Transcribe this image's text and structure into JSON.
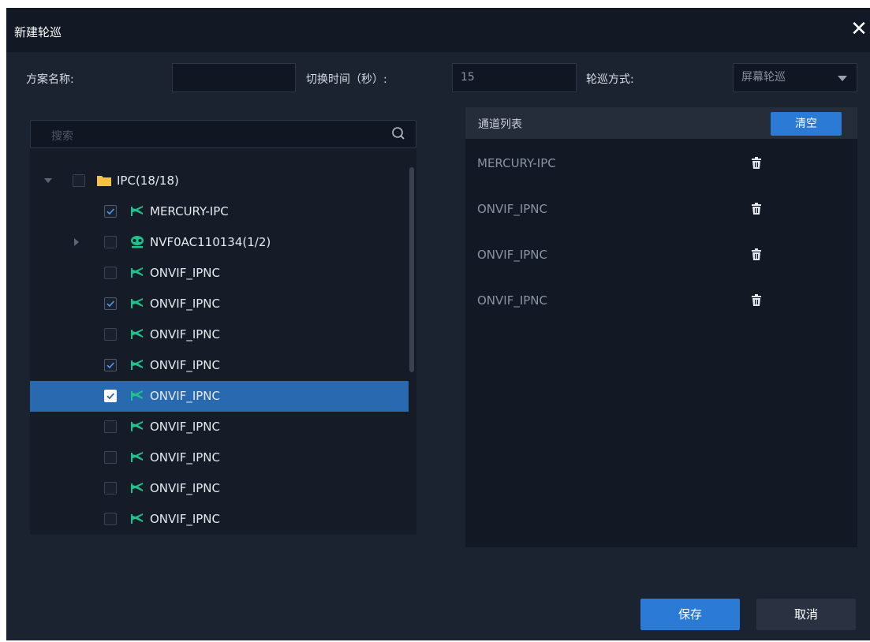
{
  "dialog": {
    "title": "新建轮巡",
    "close_glyph": "✕"
  },
  "form": {
    "scheme_label": "方案名称:",
    "scheme_value": "",
    "switch_label": "切换时间（秒）:",
    "switch_value": "15",
    "mode_label": "轮巡方式:",
    "mode_value": "屏幕轮巡"
  },
  "tree": {
    "search_placeholder": "搜索",
    "root": {
      "label": "IPC(18/18)",
      "checked": false,
      "expanded": true
    },
    "items": [
      {
        "label": "MERCURY-IPC",
        "checked": true,
        "type": "camera"
      },
      {
        "label": "NVF0AC110134(1/2)",
        "checked": false,
        "type": "nvr"
      },
      {
        "label": "ONVIF_IPNC",
        "checked": false,
        "type": "camera"
      },
      {
        "label": "ONVIF_IPNC",
        "checked": true,
        "type": "camera"
      },
      {
        "label": "ONVIF_IPNC",
        "checked": false,
        "type": "camera"
      },
      {
        "label": "ONVIF_IPNC",
        "checked": true,
        "type": "camera"
      },
      {
        "label": "ONVIF_IPNC",
        "checked": true,
        "type": "camera",
        "selected": true
      },
      {
        "label": "ONVIF_IPNC",
        "checked": false,
        "type": "camera"
      },
      {
        "label": "ONVIF_IPNC",
        "checked": false,
        "type": "camera"
      },
      {
        "label": "ONVIF_IPNC",
        "checked": false,
        "type": "camera"
      },
      {
        "label": "ONVIF_IPNC",
        "checked": false,
        "type": "camera"
      }
    ]
  },
  "channel_list": {
    "title": "通道列表",
    "clear_label": "清空",
    "channels": [
      "MERCURY-IPC",
      "ONVIF_IPNC",
      "ONVIF_IPNC",
      "ONVIF_IPNC"
    ]
  },
  "footer": {
    "save_label": "保存",
    "cancel_label": "取消"
  },
  "colors": {
    "accent": "#2b7ad6",
    "selected_row": "#2869af",
    "camera_icon": "#1fc28a",
    "folder_icon": "#f5c242"
  }
}
